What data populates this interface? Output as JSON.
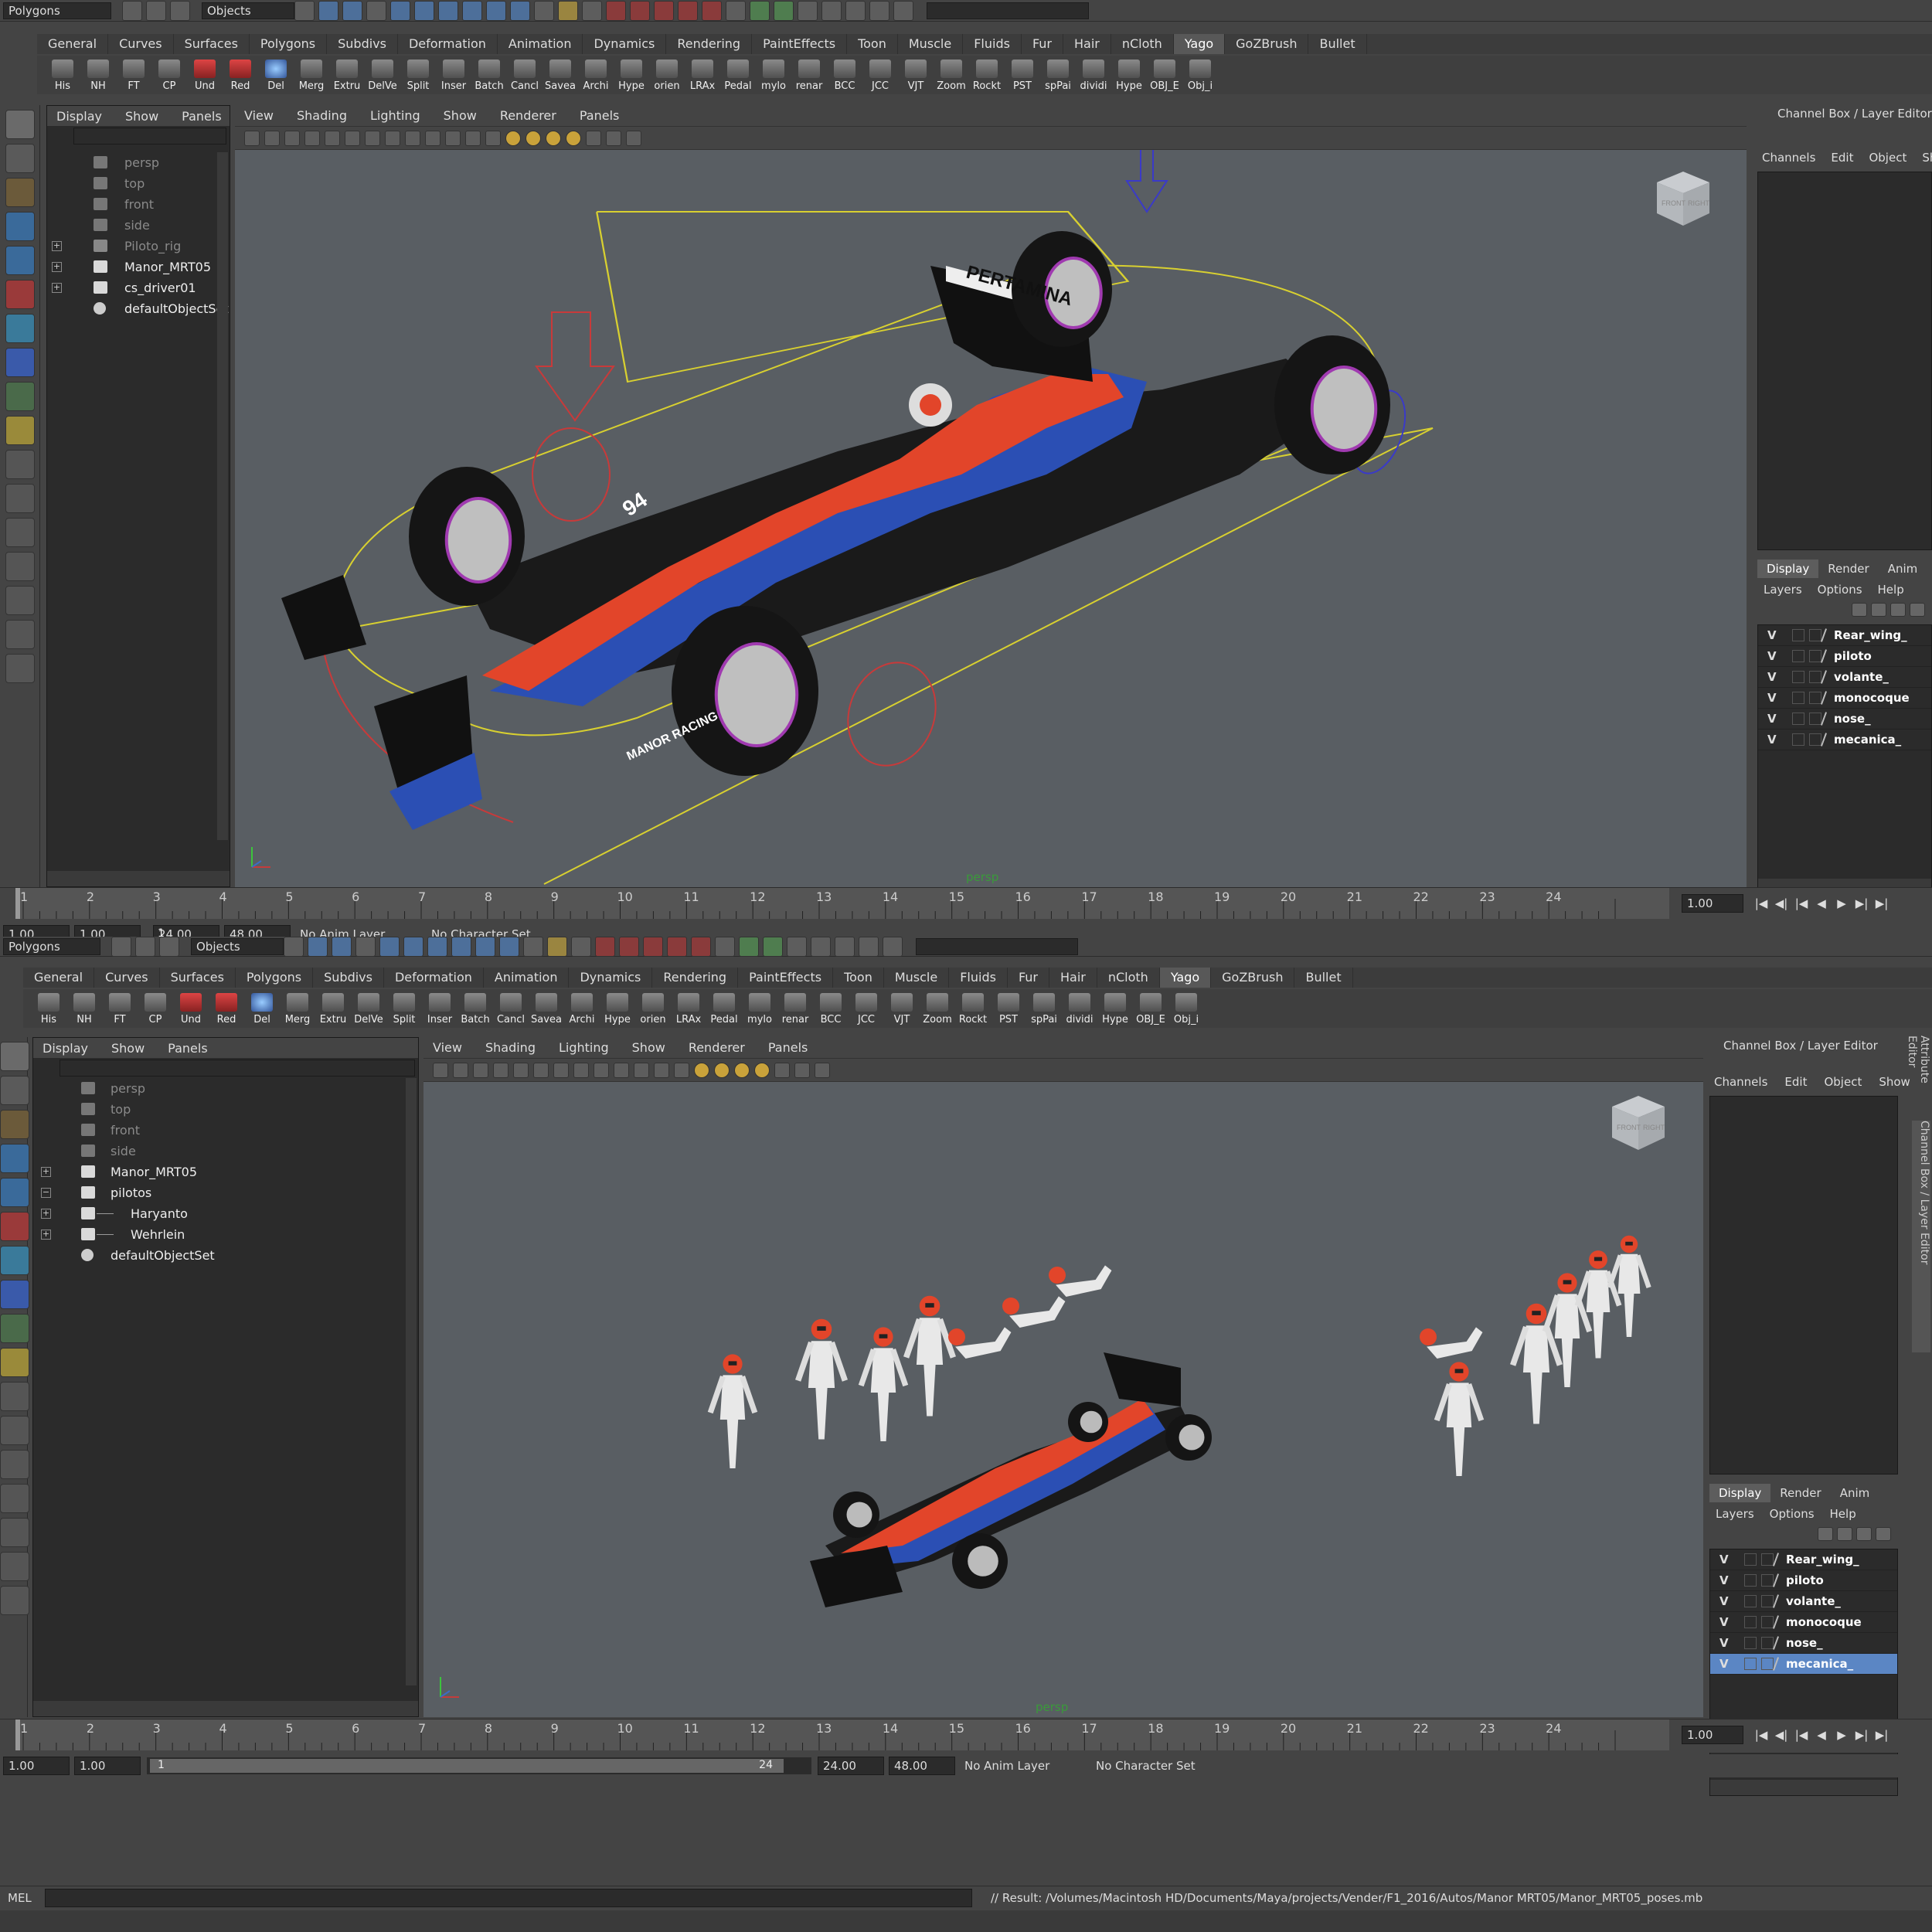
{
  "top": {
    "mode": "Polygons",
    "selection_mode": "Objects",
    "tabs": [
      "General",
      "Curves",
      "Surfaces",
      "Polygons",
      "Subdivs",
      "Deformation",
      "Animation",
      "Dynamics",
      "Rendering",
      "PaintEffects",
      "Toon",
      "Muscle",
      "Fluids",
      "Fur",
      "Hair",
      "nCloth",
      "Yago",
      "GoZBrush",
      "Bullet"
    ],
    "active_tab": "Yago",
    "shelf": [
      "His",
      "NH",
      "FT",
      "CP",
      "Und",
      "Red",
      "Del",
      "Merg",
      "Extru",
      "DelVe",
      "Split",
      "Inser",
      "Batch",
      "Cancl",
      "Savea",
      "Archi",
      "Hype",
      "orien",
      "LRAx",
      "Pedal",
      "mylo",
      "renar",
      "BCC",
      "JCC",
      "VJT",
      "Zoom",
      "Rockt",
      "PST",
      "spPai",
      "dividi",
      "Hype",
      "OBJ_E",
      "Obj_i"
    ],
    "outliner_menu": [
      "Display",
      "Show",
      "Panels"
    ],
    "outliner": [
      {
        "label": "persp",
        "kind": "camera"
      },
      {
        "label": "top",
        "kind": "camera"
      },
      {
        "label": "front",
        "kind": "camera"
      },
      {
        "label": "side",
        "kind": "camera"
      },
      {
        "label": "Piloto_rig",
        "kind": "dim",
        "expand": "+"
      },
      {
        "label": "Manor_MRT05",
        "kind": "obj",
        "expand": "+"
      },
      {
        "label": "cs_driver01",
        "kind": "obj",
        "expand": "+"
      },
      {
        "label": "defaultObjectSet",
        "kind": "set"
      }
    ],
    "viewport_menu": [
      "View",
      "Shading",
      "Lighting",
      "Show",
      "Renderer",
      "Panels"
    ],
    "camera_label": "persp",
    "view_cube": {
      "front": "FRONT",
      "right": "RIGHT"
    },
    "channel_box_title": "Channel Box / Layer Editor",
    "channel_menu": [
      "Channels",
      "Edit",
      "Object",
      "Sh"
    ],
    "layer_tabs": [
      "Display",
      "Render",
      "Anim"
    ],
    "layer_menu": [
      "Layers",
      "Options",
      "Help"
    ],
    "layers": [
      {
        "v": "V",
        "name": "Rear_wing_"
      },
      {
        "v": "V",
        "name": "piloto"
      },
      {
        "v": "V",
        "name": "volante_"
      },
      {
        "v": "V",
        "name": "monocoque"
      },
      {
        "v": "V",
        "name": "nose_"
      },
      {
        "v": "V",
        "name": "mecanica_"
      }
    ],
    "timeline_ticks": [
      "1",
      "2",
      "3",
      "4",
      "5",
      "6",
      "7",
      "8",
      "9",
      "10",
      "11",
      "12",
      "13",
      "14",
      "15",
      "16",
      "17",
      "18",
      "19",
      "20",
      "21",
      "22",
      "23",
      "24"
    ],
    "current_frame": "1.00",
    "range": {
      "start": "1.00",
      "start2": "1.00",
      "mid": "1",
      "end": "24.00",
      "end2": "48.00"
    },
    "anim_layer": "No Anim Layer",
    "char_set": "No Character Set",
    "car_text": {
      "sponsor": "PERTAMINA",
      "number": "94",
      "team": "MANOR RACING"
    }
  },
  "bottom": {
    "mode": "Polygons",
    "selection_mode": "Objects",
    "tabs": [
      "General",
      "Curves",
      "Surfaces",
      "Polygons",
      "Subdivs",
      "Deformation",
      "Animation",
      "Dynamics",
      "Rendering",
      "PaintEffects",
      "Toon",
      "Muscle",
      "Fluids",
      "Fur",
      "Hair",
      "nCloth",
      "Yago",
      "GoZBrush",
      "Bullet"
    ],
    "active_tab": "Yago",
    "shelf": [
      "His",
      "NH",
      "FT",
      "CP",
      "Und",
      "Red",
      "Del",
      "Merg",
      "Extru",
      "DelVe",
      "Split",
      "Inser",
      "Batch",
      "Cancl",
      "Savea",
      "Archi",
      "Hype",
      "orien",
      "LRAx",
      "Pedal",
      "mylo",
      "renar",
      "BCC",
      "JCC",
      "VJT",
      "Zoom",
      "Rockt",
      "PST",
      "spPai",
      "dividi",
      "Hype",
      "OBJ_E",
      "Obj_i"
    ],
    "outliner_menu": [
      "Display",
      "Show",
      "Panels"
    ],
    "outliner": [
      {
        "label": "persp",
        "kind": "camera"
      },
      {
        "label": "top",
        "kind": "camera"
      },
      {
        "label": "front",
        "kind": "camera"
      },
      {
        "label": "side",
        "kind": "camera"
      },
      {
        "label": "Manor_MRT05",
        "kind": "obj",
        "expand": "+"
      },
      {
        "label": "pilotos",
        "kind": "obj",
        "expand": "−"
      },
      {
        "label": "Haryanto",
        "kind": "child",
        "expand": "+"
      },
      {
        "label": "Wehrlein",
        "kind": "child",
        "expand": "+"
      },
      {
        "label": "defaultObjectSet",
        "kind": "set"
      }
    ],
    "viewport_menu": [
      "View",
      "Shading",
      "Lighting",
      "Show",
      "Renderer",
      "Panels"
    ],
    "camera_label": "persp",
    "view_cube": {
      "front": "FRONT",
      "right": "RIGHT"
    },
    "channel_box_title": "Channel Box / Layer Editor",
    "channel_menu": [
      "Channels",
      "Edit",
      "Object",
      "Show"
    ],
    "side_tabs": [
      "Attribute Editor",
      "Channel Box / Layer Editor"
    ],
    "layer_tabs": [
      "Display",
      "Render",
      "Anim"
    ],
    "layer_menu": [
      "Layers",
      "Options",
      "Help"
    ],
    "layers": [
      {
        "v": "V",
        "name": "Rear_wing_"
      },
      {
        "v": "V",
        "name": "piloto"
      },
      {
        "v": "V",
        "name": "volante_"
      },
      {
        "v": "V",
        "name": "monocoque"
      },
      {
        "v": "V",
        "name": "nose_"
      },
      {
        "v": "V",
        "name": "mecanica_",
        "selected": true
      }
    ],
    "timeline_ticks": [
      "1",
      "2",
      "3",
      "4",
      "5",
      "6",
      "7",
      "8",
      "9",
      "10",
      "11",
      "12",
      "13",
      "14",
      "15",
      "16",
      "17",
      "18",
      "19",
      "20",
      "21",
      "22",
      "23",
      "24"
    ],
    "current_frame": "1.00",
    "range": {
      "start": "1.00",
      "start2": "1.00",
      "mid": "1",
      "mid_end": "24",
      "end": "24.00",
      "end2": "48.00"
    },
    "anim_layer": "No Anim Layer",
    "char_set": "No Character Set",
    "mel_label": "MEL",
    "result": "// Result: /Volumes/Macintosh HD/Documents/Maya/projects/Vender/F1_2016/Autos/Manor MRT05/Manor_MRT05_poses.mb"
  },
  "colors": {
    "accent": "#5b86c4",
    "car_red": "#e2452a",
    "car_blue": "#2b4fb4",
    "rig_yellow": "#d8d030",
    "rig_red": "#c83a3a",
    "rig_blue": "#3a3ac8"
  }
}
